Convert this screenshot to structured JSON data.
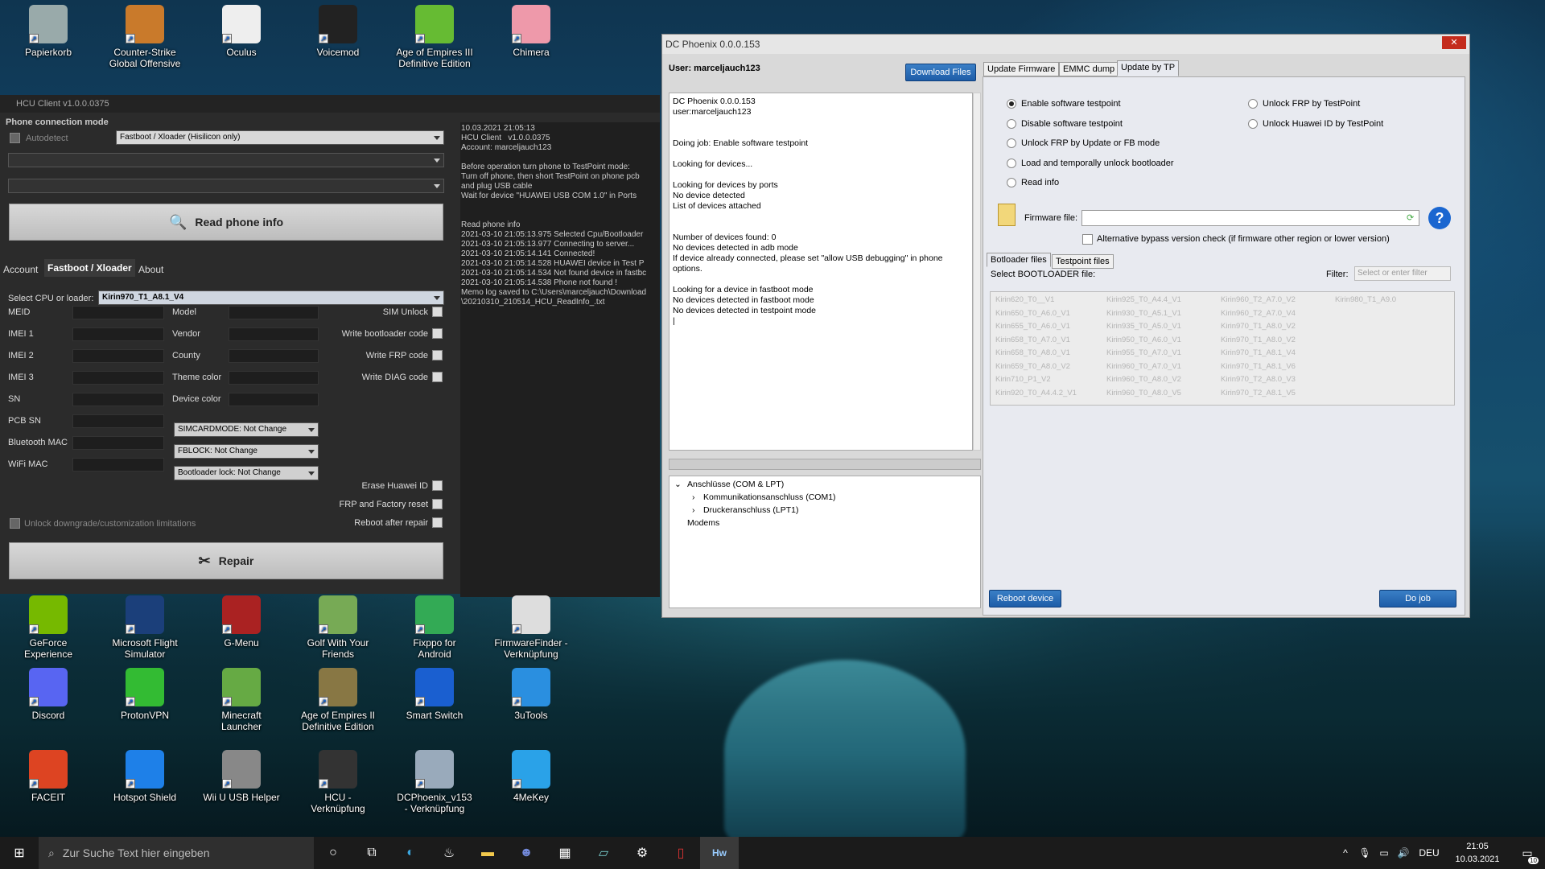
{
  "desktop": {
    "top_icons": [
      {
        "label": "Papierkorb",
        "icon": "recycle-bin-icon"
      },
      {
        "label": "Counter-Strike Global Offensive",
        "icon": "csgo-icon"
      },
      {
        "label": "Oculus",
        "icon": "oculus-icon"
      },
      {
        "label": "Voicemod",
        "icon": "voicemod-icon"
      },
      {
        "label": "Age of Empires III Definitive Edition",
        "icon": "aoe3-icon"
      },
      {
        "label": "Chimera",
        "icon": "chimera-icon"
      }
    ],
    "row1": [
      {
        "label": "GeForce Experience",
        "icon": "geforce-icon"
      },
      {
        "label": "Microsoft Flight Simulator",
        "icon": "flight-sim-icon"
      },
      {
        "label": "G-Menu",
        "icon": "gmenu-icon"
      },
      {
        "label": "Golf With Your Friends",
        "icon": "golf-icon"
      },
      {
        "label": "Fixppo for Android",
        "icon": "fixppo-icon"
      },
      {
        "label": "FirmwareFinder - Verknüpfung",
        "icon": "firmwarefinder-icon"
      }
    ],
    "row2": [
      {
        "label": "Discord",
        "icon": "discord-icon"
      },
      {
        "label": "ProtonVPN",
        "icon": "protonvpn-icon"
      },
      {
        "label": "Minecraft Launcher",
        "icon": "minecraft-icon"
      },
      {
        "label": "Age of Empires II Definitive Edition",
        "icon": "aoe2-icon"
      },
      {
        "label": "Smart Switch",
        "icon": "smart-switch-icon"
      },
      {
        "label": "3uTools",
        "icon": "3utools-icon"
      }
    ],
    "row3": [
      {
        "label": "FACEIT",
        "icon": "faceit-icon"
      },
      {
        "label": "Hotspot Shield",
        "icon": "hotspot-shield-icon"
      },
      {
        "label": "Wii U USB Helper",
        "icon": "wiiu-icon"
      },
      {
        "label": "HCU - Verknüpfung",
        "icon": "hcu-icon"
      },
      {
        "label": "DCPhoenix_v153 - Verknüpfung",
        "icon": "dcphoenix-icon"
      },
      {
        "label": "4MeKey",
        "icon": "4mekey-icon"
      }
    ]
  },
  "hcu": {
    "title": "HCU Client   v1.0.0.0375",
    "conn_mode_label": "Phone connection mode",
    "autodetect": "Autodetect",
    "mode_value": "Fastboot / Xloader (Hisilicon only)",
    "read_phone_info": "Read phone info",
    "tabs": [
      "Account",
      "Fastboot / Xloader",
      "About"
    ],
    "select_cpu_label": "Select CPU or  loader:",
    "cpu_value": "Kirin970_T1_A8.1_V4",
    "left_fields": [
      "MEID",
      "IMEI 1",
      "IMEI 2",
      "IMEI 3",
      "SN",
      "PCB SN",
      "Bluetooth  MAC",
      "WiFi MAC"
    ],
    "mid_fields": [
      "Model",
      "Vendor",
      "County",
      "Theme color",
      "Device color"
    ],
    "combos": [
      "SIMCARDMODE: Not Change",
      "FBLOCK: Not Change",
      "Bootloader lock: Not Change"
    ],
    "right_checks": [
      "SIM Unlock",
      "Write bootloader code",
      "Write FRP code",
      "Write DIAG code"
    ],
    "bottom_checks": [
      "Erase Huawei ID",
      "FRP and Factory reset",
      "Reboot after repair"
    ],
    "unlock_downgrade": "Unlock downgrade/customization limitations",
    "repair": "Repair",
    "log": "10.03.2021 21:05:13\nHCU Client   v1.0.0.0375\nAccount: marceljauch123\n\nBefore operation turn phone to TestPoint mode:\nTurn off phone, then short TestPoint on phone pcb\nand plug USB cable\nWait for device \"HUAWEI USB COM 1.0\" in Ports\n\n\nRead phone info\n2021-03-10 21:05:13.975 Selected Cpu/Bootloader\n2021-03-10 21:05:13.977 Connecting to server...\n2021-03-10 21:05:14.141 Connected!\n2021-03-10 21:05:14.528 HUAWEI device in Test P\n2021-03-10 21:05:14.534 Not found device in fastbc\n2021-03-10 21:05:14.538 Phone not found !\nMemo log saved to C:\\Users\\marceljauch\\Download\n\\20210310_210514_HCU_ReadInfo_.txt"
  },
  "dcp": {
    "title": "DC Phoenix 0.0.0.153",
    "user": "User: marceljauch123",
    "download_files": "Download Files",
    "tabs": [
      "Update Firmware",
      "EMMC dump",
      "Update by TP"
    ],
    "log": "DC Phoenix 0.0.0.153\nuser:marceljauch123\n\n\nDoing job: Enable software testpoint\n\nLooking for devices...\n\nLooking for devices by ports\nNo device detected\nList of devices attached\n\n\nNumber of devices found: 0\nNo devices detected in adb mode\nIf device already connected, please set \"allow USB debugging\" in phone\noptions.\n\nLooking for a device in fastboot mode\nNo devices detected in fastboot mode\nNo devices detected in testpoint mode\n|",
    "tree": {
      "root": "Anschlüsse (COM & LPT)",
      "children": [
        "Kommunikationsanschluss (COM1)",
        "Druckeranschluss (LPT1)"
      ],
      "other": "Modems"
    },
    "radios_left": [
      "Enable software testpoint",
      "Disable software testpoint",
      "Unlock FRP by Update or FB mode",
      "Load and temporally unlock bootloader",
      "Read info"
    ],
    "radios_right": [
      "Unlock FRP by TestPoint",
      "Unlock Huawei ID by TestPoint"
    ],
    "firmware_label": "Firmware file:",
    "alt_bypass": "Alternative bypass version check (if firmware other region or lower version)",
    "sub_tabs": [
      "Botloader files",
      "Testpoint files"
    ],
    "select_bl": "Select BOOTLOADER file:",
    "filter_label": "Filter:",
    "filter_placeholder": "Select or enter filter",
    "bl_col1": [
      "Kirin620_T0__V1",
      "Kirin650_T0_A6.0_V1",
      "Kirin655_T0_A6.0_V1",
      "Kirin658_T0_A7.0_V1",
      "Kirin658_T0_A8.0_V1",
      "Kirin659_T0_A8.0_V2",
      "Kirin710_P1_V2",
      "Kirin920_T0_A4.4.2_V1"
    ],
    "bl_col2": [
      "Kirin925_T0_A4.4_V1",
      "Kirin930_T0_A5.1_V1",
      "Kirin935_T0_A5.0_V1",
      "Kirin950_T0_A6.0_V1",
      "Kirin955_T0_A7.0_V1",
      "Kirin960_T0_A7.0_V1",
      "Kirin960_T0_A8.0_V2",
      "Kirin960_T0_A8.0_V5"
    ],
    "bl_col3": [
      "Kirin960_T2_A7.0_V2",
      "Kirin960_T2_A7.0_V4",
      "Kirin970_T1_A8.0_V2",
      "Kirin970_T1_A8.0_V2",
      "Kirin970_T1_A8.1_V4",
      "Kirin970_T1_A8.1_V6",
      "Kirin970_T2_A8.0_V3",
      "Kirin970_T2_A8.1_V5"
    ],
    "bl_col4": [
      "Kirin980_T1_A9.0"
    ],
    "reboot_device": "Reboot device",
    "do_job": "Do job"
  },
  "taskbar": {
    "search_placeholder": "Zur Suche Text hier eingeben",
    "lang": "DEU",
    "time": "21:05",
    "date": "10.03.2021",
    "notif_count": "10"
  }
}
